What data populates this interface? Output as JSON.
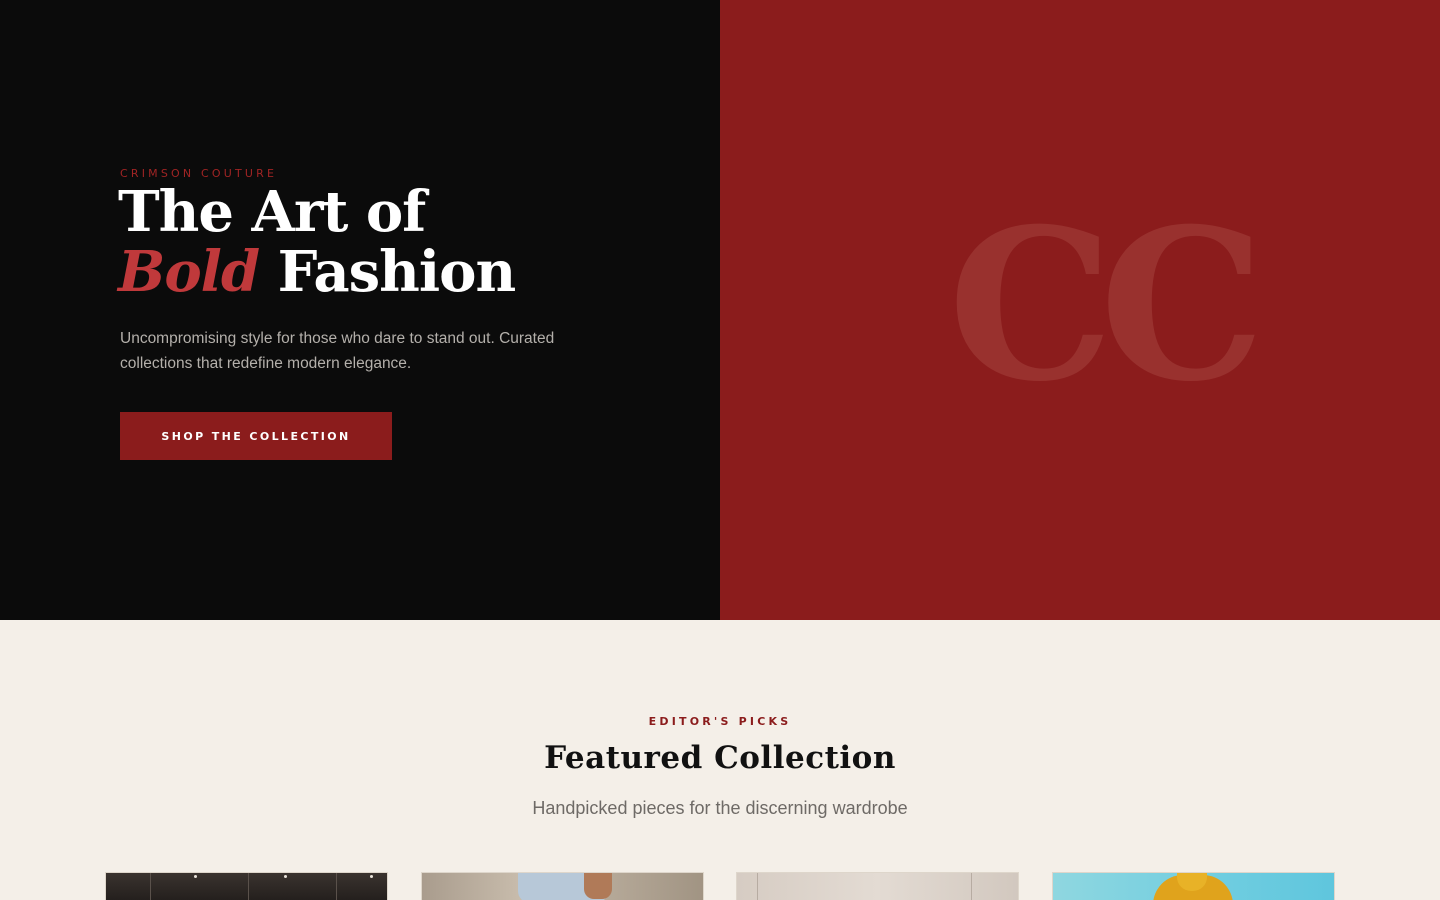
{
  "hero": {
    "eyebrow": "CRIMSON COUTURE",
    "title_line1": "The Art of",
    "title_accent": "Bold",
    "title_line2_rest": " Fashion",
    "subtitle": "Uncompromising style for those who dare to stand out. Curated collections that redefine modern elegance.",
    "cta_label": "SHOP THE COLLECTION",
    "monogram": "CC"
  },
  "featured": {
    "eyebrow": "EDITOR'S PICKS",
    "title": "Featured Collection",
    "subtitle": "Handpicked pieces for the discerning wardrobe"
  },
  "colors": {
    "dark": "#0b0b0b",
    "crimson": "#8b1c1c",
    "accent": "#c0393b",
    "cream": "#f4efe8"
  }
}
